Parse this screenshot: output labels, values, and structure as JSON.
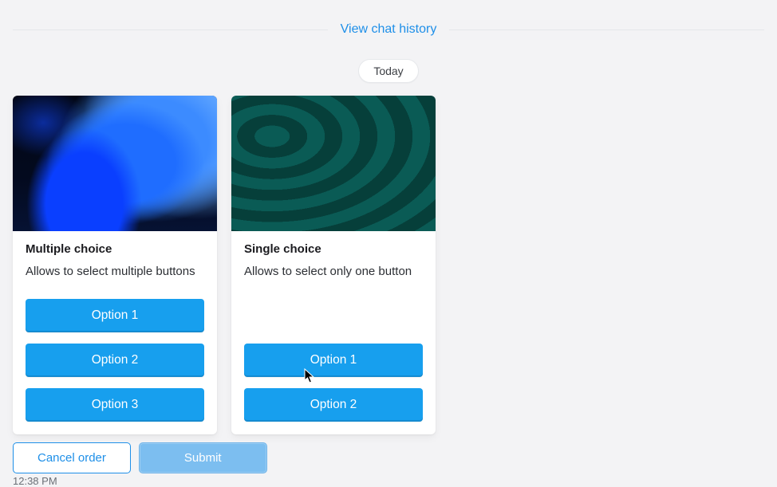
{
  "header": {
    "history_link": "View chat history",
    "date_pill": "Today"
  },
  "cards": [
    {
      "title": "Multiple choice",
      "desc": "Allows to select multiple buttons",
      "options": [
        "Option 1",
        "Option 2",
        "Option 3"
      ]
    },
    {
      "title": "Single choice",
      "desc": "Allows to select only one button",
      "options": [
        "Option 1",
        "Option 2"
      ]
    }
  ],
  "actions": {
    "cancel": "Cancel order",
    "submit": "Submit"
  },
  "timestamp": "12:38 PM",
  "colors": {
    "link": "#1e8fe8",
    "primary_button": "#179fee",
    "submit_button": "#7cbef0"
  }
}
